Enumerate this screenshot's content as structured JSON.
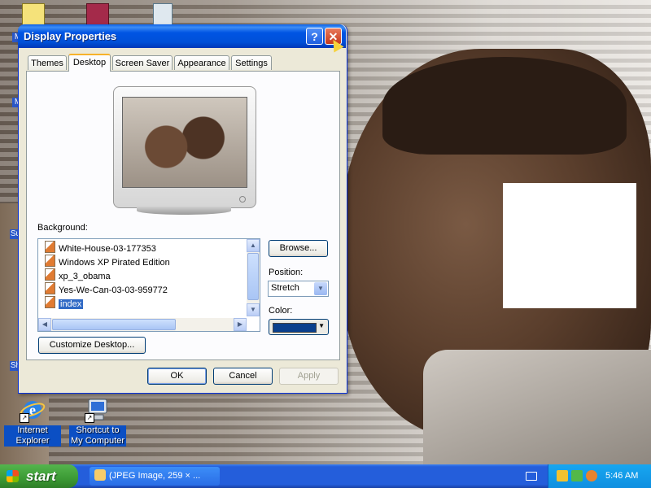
{
  "desktop": {
    "icons": [
      {
        "label": "Internet Explorer",
        "icon": "internet-explorer-icon"
      },
      {
        "label": "Shortcut to My Computer",
        "icon": "my-computer-icon"
      }
    ]
  },
  "dialog": {
    "title": "Display Properties",
    "help_glyph": "?",
    "close_glyph": "✕",
    "tabs": [
      {
        "label": "Themes",
        "active": false
      },
      {
        "label": "Desktop",
        "active": true
      },
      {
        "label": "Screen Saver",
        "active": false
      },
      {
        "label": "Appearance",
        "active": false
      },
      {
        "label": "Settings",
        "active": false
      }
    ],
    "background_label": "Background:",
    "background_items": [
      {
        "label": "White-House-03-177353",
        "selected": false
      },
      {
        "label": "Windows XP Pirated Edition",
        "selected": false
      },
      {
        "label": "xp_3_obama",
        "selected": false
      },
      {
        "label": "Yes-We-Can-03-03-959772",
        "selected": false
      },
      {
        "label": "index",
        "selected": true
      }
    ],
    "browse_label": "Browse...",
    "position_label": "Position:",
    "position_value": "Stretch",
    "color_label": "Color:",
    "color_value": "#0a3f8c",
    "customize_label": "Customize Desktop...",
    "ok_label": "OK",
    "cancel_label": "Cancel",
    "apply_label": "Apply"
  },
  "taskbar": {
    "start_label": "start",
    "task_item": "(JPEG Image, 259 × ...",
    "clock": "5:46 AM"
  },
  "colors": {
    "title_blue": "#0054e3",
    "dialog_face": "#ece9d8",
    "selection": "#316ac5",
    "start_green": "#3c9a35",
    "tray_blue": "#0f8fe0"
  }
}
